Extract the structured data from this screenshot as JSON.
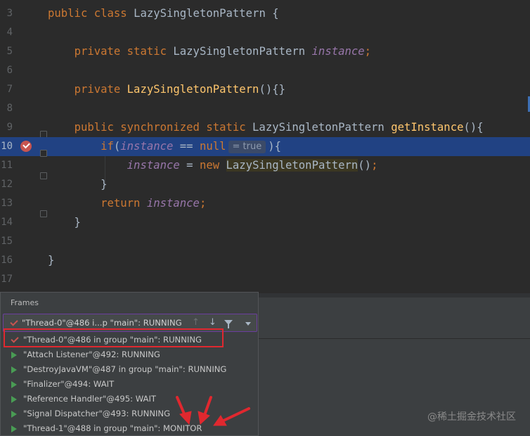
{
  "editor": {
    "lines": [
      {
        "n": "3",
        "html": "<span class=\"kw\">public class </span>LazySingletonPattern {"
      },
      {
        "n": "4",
        "html": ""
      },
      {
        "n": "5",
        "html": "    <span class=\"kw\">private static </span>LazySingletonPattern <span class=\"it\">instance</span><span class=\"kw\">;</span>"
      },
      {
        "n": "6",
        "html": ""
      },
      {
        "n": "7",
        "html": "    <span class=\"kw\">private </span><span class=\"fn\">LazySingletonPattern</span>(){}"
      },
      {
        "n": "8",
        "html": ""
      },
      {
        "n": "9",
        "html": "    <span class=\"kw\">public synchronized static </span>LazySingletonPattern <span class=\"fn\">getInstance</span>(){"
      },
      {
        "n": "10",
        "html": "        <span class=\"kw\">if</span>(<span class=\"it\">instance</span> == <span class=\"kw\">null</span><span class=\"inlay\">= true</span>){"
      },
      {
        "n": "11",
        "html": "            <span class=\"it\">instance</span> = <span class=\"kw\">new </span><span class=\"ctorhl\">LazySingletonPattern</span>()<span class=\"kw\">;</span>"
      },
      {
        "n": "12",
        "html": "        }"
      },
      {
        "n": "13",
        "html": "        <span class=\"kw\">return </span><span class=\"it\">instance</span><span class=\"kw\">;</span>"
      },
      {
        "n": "14",
        "html": "    }"
      },
      {
        "n": "15",
        "html": ""
      },
      {
        "n": "16",
        "html": "}"
      },
      {
        "n": "17",
        "html": ""
      }
    ],
    "highlighted_line": "10",
    "inline_value": "= true"
  },
  "frames_panel": {
    "title": "Frames",
    "selected_thread": "\"Thread-0\"@486 i...p \"main\": RUNNING",
    "threads": [
      {
        "label": "\"Thread-0\"@486 in group \"main\": RUNNING",
        "icon": "check-icon"
      },
      {
        "label": "\"Attach Listener\"@492: RUNNING",
        "icon": "play-icon"
      },
      {
        "label": "\"DestroyJavaVM\"@487 in group \"main\": RUNNING",
        "icon": "play-icon"
      },
      {
        "label": "\"Finalizer\"@494: WAIT",
        "icon": "play-icon"
      },
      {
        "label": "\"Reference Handler\"@495: WAIT",
        "icon": "play-icon"
      },
      {
        "label": "\"Signal Dispatcher\"@493: RUNNING",
        "icon": "play-icon"
      },
      {
        "label": "\"Thread-1\"@488 in group \"main\": MONITOR",
        "icon": "play-icon"
      }
    ]
  },
  "watermark": "@稀土掘金技术社区",
  "colors": {
    "keyword": "#cc7832",
    "method": "#ffc66d",
    "field": "#9876aa",
    "selection": "#214283",
    "annotation": "#e0282f"
  }
}
